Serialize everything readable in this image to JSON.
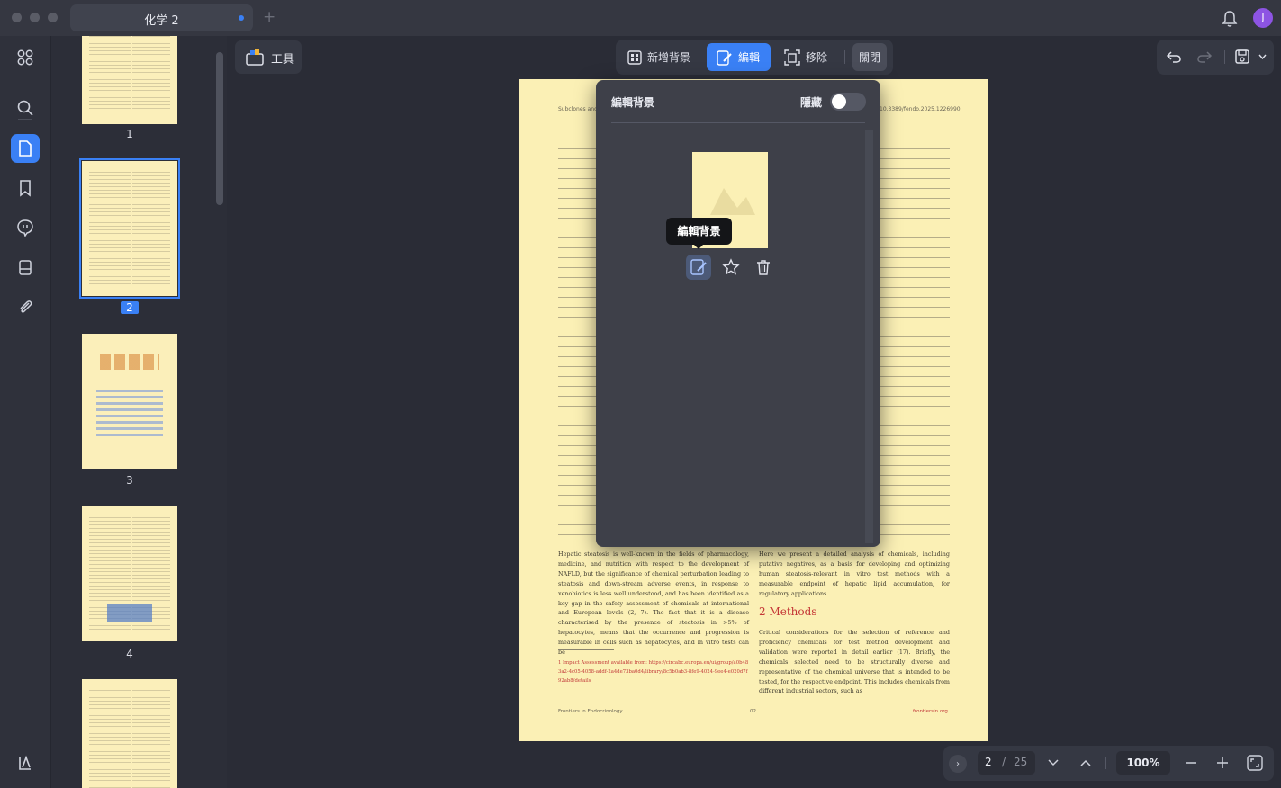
{
  "window": {
    "tab_title": "化学 2"
  },
  "user": {
    "avatar_initial": "J"
  },
  "toolbar": {
    "tools_label": "工具"
  },
  "center_toolbar": {
    "add_bg": "新增背景",
    "edit": "編輯",
    "remove": "移除",
    "close": "關閉"
  },
  "thumbnails": [
    {
      "num": "1"
    },
    {
      "num": "2"
    },
    {
      "num": "3"
    },
    {
      "num": "4"
    }
  ],
  "popup": {
    "title": "編輯背景",
    "hide_label": "隱藏",
    "hide_on": false,
    "tooltip": "編輯背景"
  },
  "page": {
    "header_left": "Subclones and ...",
    "header_right": "10.3389/fendo.2025.1226990",
    "section_heading": "2 Methods",
    "para_left": "Hepatic steatosis is well-known in the fields of pharmacology, medicine, and nutrition with respect to the development of NAFLD, but the significance of chemical perturbation leading to steatosis and down-stream adverse events, in response to xenobiotics is less well understood, and has been identified as a key gap in the safety assessment of chemicals at international and European levels (2, 7). The fact that it is a disease characterised by the presence of steatosis in >5% of hepatocytes, means that the occurrence and progression is measurable in cells such as hepatocytes, and in vitro tests can be",
    "para_right_top": "Here we present a detailed analysis of chemicals, including putative negatives, as a basis for developing and optimizing human steatosis-relevant in vitro test methods with a measurable endpoint of hepatic lipid accumulation, for regulatory applications.",
    "para_right_methods": "Critical considerations for the selection of reference and proficiency chemicals for test method development and validation were reported in detail earlier (17). Briefly, the chemicals selected need to be structurally diverse and representative of the chemical universe that is intended to be tested, for the respective endpoint. This includes chemicals from different industrial sectors, such as",
    "footnote": "1  Impact Assessment available from: https://circabc.europa.eu/ui/group/a0b483a2-4c05-4058-addf-2a4de73ba0d4/library/8c5b0ab3-8fe9-4024-9ee4-e020d7f92ab8/details",
    "footer_left": "Frontiers in Endocrinology",
    "footer_center": "02",
    "footer_right": "frontiersin.org"
  },
  "nav": {
    "current_page": "2",
    "separator": "/",
    "total_pages": "25",
    "zoom": "100%"
  },
  "colors": {
    "accent": "#3a80f5",
    "page_bg": "#fbf0b5",
    "app_bg": "#2a2c36",
    "heading_red": "#c43636"
  }
}
